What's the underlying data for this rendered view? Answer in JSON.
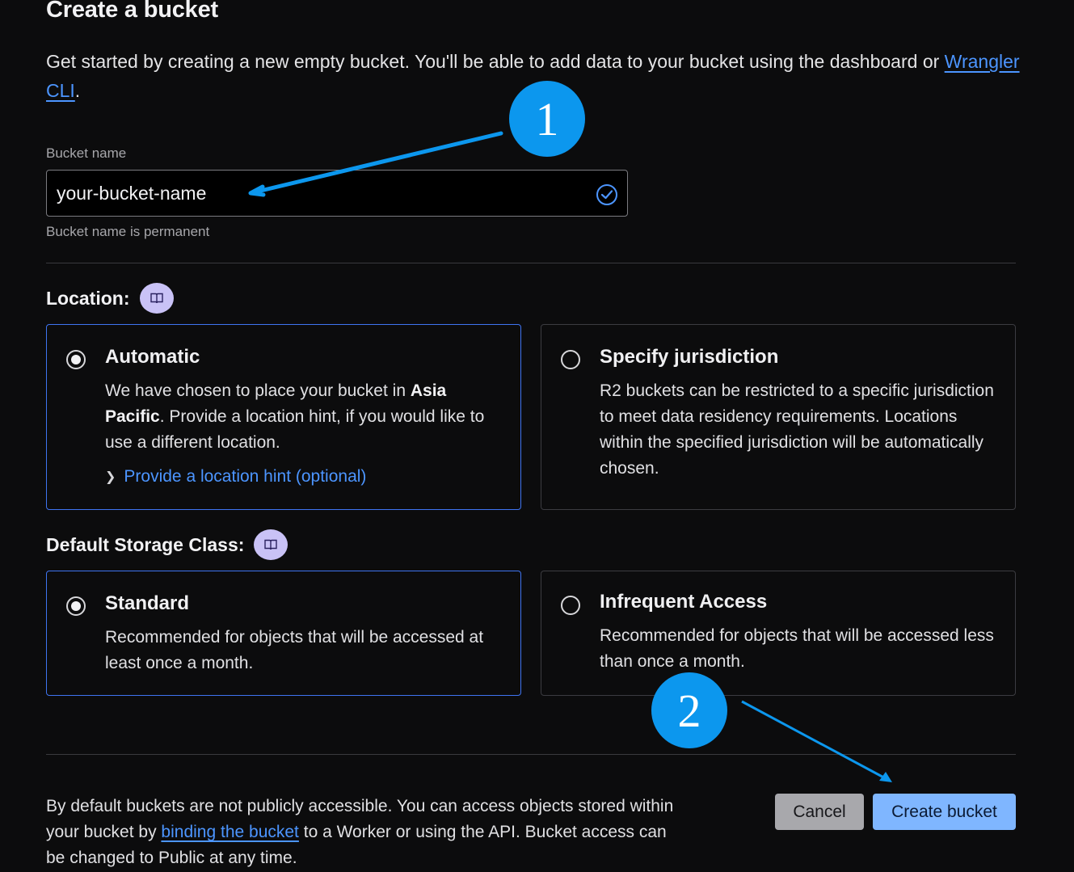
{
  "header": {
    "title": "Create a bucket",
    "intro_text": "Get started by creating a new empty bucket. You'll be able to add data to your bucket using the dashboard or",
    "intro_link": "Wrangler CLI",
    "intro_end": "."
  },
  "bucket_name": {
    "label": "Bucket name",
    "value": "your-bucket-name",
    "helper": "Bucket name is permanent",
    "valid_icon": "check-circle-icon"
  },
  "location": {
    "heading": "Location:",
    "docs_icon": "book-icon",
    "options": [
      {
        "title": "Automatic",
        "selected": true,
        "desc_1": "We have chosen to place your bucket in",
        "region": "Asia Pacific",
        "desc_2": ". Provide a location hint, if you would like to use a different location.",
        "hint_link": "Provide a location hint (optional)"
      },
      {
        "title": "Specify jurisdiction",
        "selected": false,
        "desc": "R2 buckets can be restricted to a specific jurisdiction to meet data residency requirements. Locations within the specified jurisdiction will be automatically chosen."
      }
    ]
  },
  "storage_class": {
    "heading": "Default Storage Class:",
    "docs_icon": "book-icon",
    "options": [
      {
        "title": "Standard",
        "selected": true,
        "desc": "Recommended for objects that will be accessed at least once a month."
      },
      {
        "title": "Infrequent Access",
        "selected": false,
        "desc": "Recommended for objects that will be accessed less than once a month."
      }
    ]
  },
  "footer": {
    "text_1": "By default buckets are not publicly accessible. You can access objects stored within your bucket by",
    "link": "binding the bucket",
    "text_2": "to a Worker or using the API. Bucket access can be changed to Public at any time.",
    "cancel_label": "Cancel",
    "create_label": "Create bucket"
  },
  "annotations": {
    "step_1": "1",
    "step_2": "2",
    "color": "#0c97ee"
  }
}
